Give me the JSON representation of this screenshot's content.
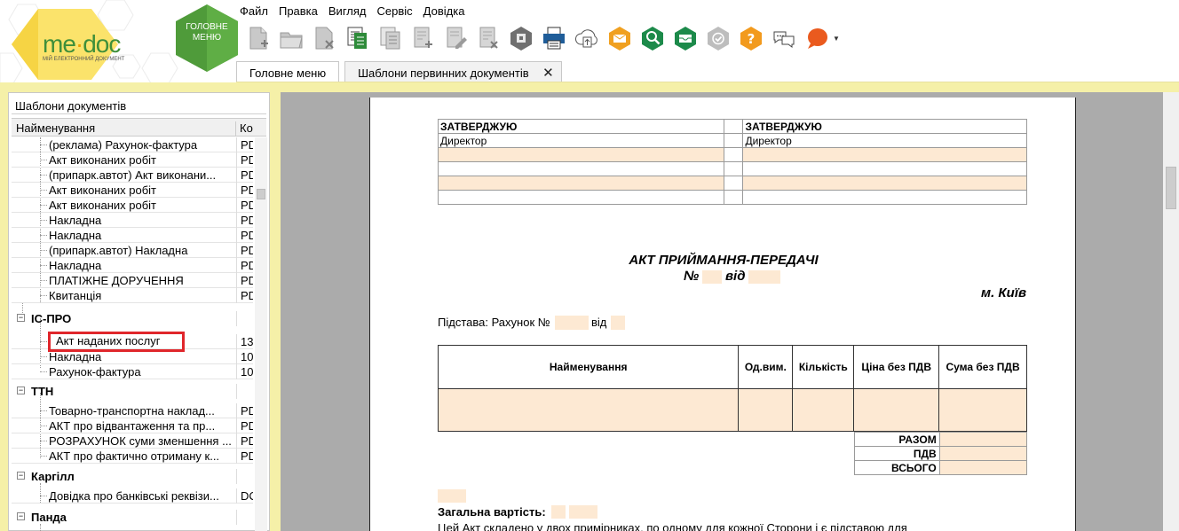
{
  "app": {
    "logo_text": "me",
    "logo_text2": "doc",
    "logo_subtitle": "МІЙ ЕЛЕКТРОННИЙ ДОКУМЕНТ",
    "home_label_line1": "ГОЛОВНЕ",
    "home_label_line2": "МЕНЮ",
    "accent_green": "#3f8f3a",
    "frame_yellow": "#f5f0a8"
  },
  "menu": [
    "Файл",
    "Правка",
    "Вигляд",
    "Сервіс",
    "Довідка"
  ],
  "toolbar_icons": [
    "new-doc-icon",
    "open-folder-icon",
    "delete-doc-icon",
    "copy-doc-icon",
    "copy-doc-gray-icon",
    "add-doc-icon",
    "edit-doc-icon",
    "remove-doc-icon",
    "archive-icon",
    "print-icon",
    "cloud-upload-icon",
    "envelope-icon",
    "search-magnifier-icon",
    "inbox-icon",
    "check-badge-icon",
    "help-icon",
    "chat-icon",
    "feedback-bubble-icon"
  ],
  "tabs": [
    {
      "label": "Головне меню",
      "active": false
    },
    {
      "label": "Шаблони первинних документів",
      "active": true
    }
  ],
  "left_panel": {
    "title": "Шаблони документів",
    "col_name": "Найменування",
    "col_code": "Ко"
  },
  "tree": {
    "rows": [
      {
        "type": "item",
        "name": "(реклама) Рахунок-фактура",
        "code": "PD"
      },
      {
        "type": "item",
        "name": "Акт виконаних робіт",
        "code": "PD"
      },
      {
        "type": "item",
        "name": "(припарк.автот) Акт виконани...",
        "code": "PD"
      },
      {
        "type": "item",
        "name": "Акт виконаних робіт",
        "code": "PD"
      },
      {
        "type": "item",
        "name": "Акт виконаних робіт",
        "code": "PD"
      },
      {
        "type": "item",
        "name": "Накладна",
        "code": "PD"
      },
      {
        "type": "item",
        "name": "Накладна",
        "code": "PD"
      },
      {
        "type": "item",
        "name": "(припарк.автот) Накладна",
        "code": "PD"
      },
      {
        "type": "item",
        "name": "Накладна",
        "code": "PD"
      },
      {
        "type": "item",
        "name": "ПЛАТІЖНЕ ДОРУЧЕННЯ",
        "code": "PD"
      },
      {
        "type": "item",
        "name": "Квитанція",
        "code": "PD"
      },
      {
        "type": "group",
        "name": "ІС-ПРО",
        "code": ""
      },
      {
        "type": "item",
        "name": "Акт наданих послуг",
        "code": "13",
        "highlight": true
      },
      {
        "type": "item",
        "name": "Накладна",
        "code": "10"
      },
      {
        "type": "item",
        "name": "Рахунок-фактура",
        "code": "10"
      },
      {
        "type": "group",
        "name": "ТТН",
        "code": ""
      },
      {
        "type": "item",
        "name": "Товарно-транспортна наклад...",
        "code": "PD"
      },
      {
        "type": "item",
        "name": "АКТ про відвантаження та пр...",
        "code": "PD"
      },
      {
        "type": "item",
        "name": "РОЗРАХУНОК суми зменшення ...",
        "code": "PD"
      },
      {
        "type": "item",
        "name": "АКТ про фактично отриману к...",
        "code": "PD"
      },
      {
        "type": "group",
        "name": "Каргілл",
        "code": ""
      },
      {
        "type": "item",
        "name": "Довідка про банківські реквізи...",
        "code": "DC"
      },
      {
        "type": "group",
        "name": "Панда",
        "code": ""
      }
    ]
  },
  "document": {
    "approve_left": "ЗАТВЕРДЖУЮ",
    "approve_right": "ЗАТВЕРДЖУЮ",
    "director_left": "Директор",
    "director_right": "Директор",
    "title": "АКТ ПРИЙМАННЯ-ПЕРЕДАЧІ",
    "number_prefix": "№",
    "number_from": "від",
    "city": "м. Київ",
    "basis_label": "Підстава: Рахунок №",
    "basis_from": "від",
    "col_name": "Найменування",
    "col_unit": "Од.вим.",
    "col_qty": "Кількість",
    "col_price": "Ціна без ПДВ",
    "col_sum": "Сума без ПДВ",
    "total_label": "РАЗОМ",
    "vat_label": "ПДВ",
    "grand_label": "ВСЬОГО",
    "total_cost_label": "Загальна вартість:",
    "footer_text": "Цей Акт складено у двох примірниках, по одному для кожної Сторони і є підставою для",
    "peach_color": "#fde9d3"
  }
}
